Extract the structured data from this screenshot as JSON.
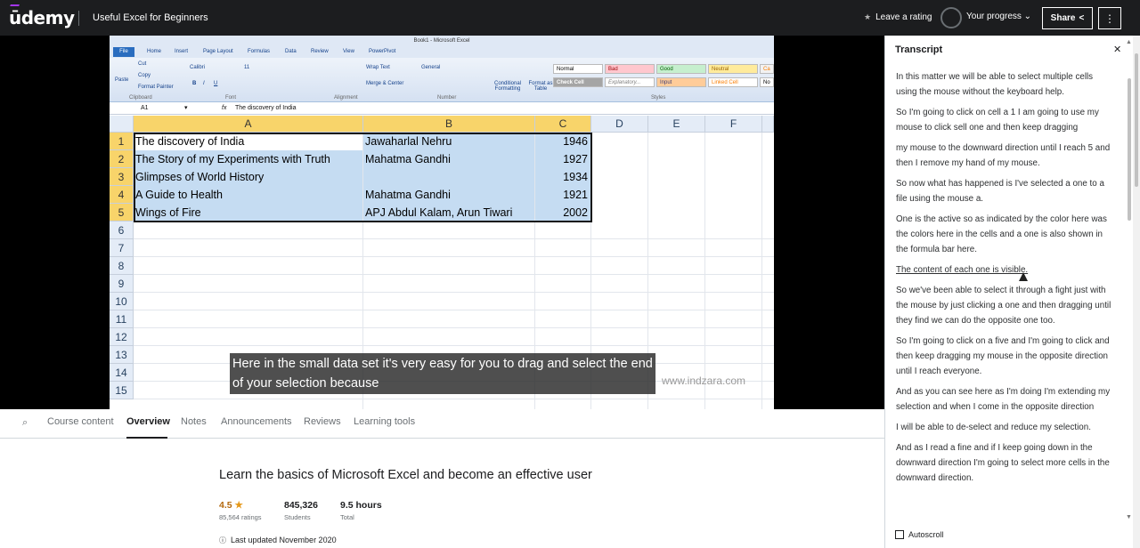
{
  "topbar": {
    "logo": "ūdemy",
    "course_title": "Useful Excel for Beginners",
    "leave_rating": "Leave a rating",
    "progress_label": "Your progress",
    "share_label": "Share",
    "more_icon": "kebab-icon"
  },
  "excel": {
    "window_title": "Book1 - Microsoft Excel",
    "file_tab": "File",
    "ribbon_tabs": [
      "Home",
      "Insert",
      "Page Layout",
      "Formulas",
      "Data",
      "Review",
      "View",
      "PowerPivot"
    ],
    "clipboard": {
      "paste": "Paste",
      "cut": "Cut",
      "copy": "Copy",
      "format_painter": "Format Painter",
      "group": "Clipboard"
    },
    "font": {
      "name": "Calibri",
      "size": "11",
      "group": "Font"
    },
    "alignment": {
      "wrap": "Wrap Text",
      "merge": "Merge & Center",
      "group": "Alignment"
    },
    "number": {
      "format": "General",
      "group": "Number"
    },
    "styles": {
      "conditional": "Conditional Formatting",
      "format_table": "Format as Table",
      "group": "Styles",
      "cells": [
        "Normal",
        "Bad",
        "Good",
        "Neutral",
        "Ca",
        "Check Cell",
        "Explanatory...",
        "Input",
        "Linked Cell",
        "No"
      ]
    },
    "name_box": "A1",
    "fx": "fx",
    "formula": "The discovery of India",
    "columns": [
      "A",
      "B",
      "C",
      "D",
      "E",
      "F"
    ],
    "rows": [
      "1",
      "2",
      "3",
      "4",
      "5",
      "6",
      "7",
      "8",
      "9",
      "10",
      "11",
      "12",
      "13",
      "14",
      "15"
    ],
    "data": [
      {
        "a": "The discovery of India",
        "b": "Jawaharlal Nehru",
        "c": "1946"
      },
      {
        "a": "The Story of my Experiments with Truth",
        "b": "Mahatma Gandhi",
        "c": "1927"
      },
      {
        "a": "Glimpses of World History",
        "b": "",
        "c": "1934"
      },
      {
        "a": "A Guide to Health",
        "b": "Mahatma Gandhi",
        "c": "1921"
      },
      {
        "a": "Wings of Fire",
        "b": "APJ Abdul Kalam, Arun Tiwari",
        "c": "2002"
      }
    ]
  },
  "video": {
    "subtitle": "Here in the small data set it's very easy for you to drag and select the end of your selection because",
    "watermark": "www.indzara.com"
  },
  "tabs": {
    "items": [
      "Course content",
      "Overview",
      "Notes",
      "Announcements",
      "Reviews",
      "Learning tools"
    ],
    "active": "Overview"
  },
  "overview": {
    "title": "Learn the basics of Microsoft Excel and become an effective user",
    "rating": "4.5",
    "ratings_count": "85,564 ratings",
    "students": "845,326",
    "students_label": "Students",
    "hours": "9.5 hours",
    "hours_label": "Total",
    "updated": "Last updated November 2020"
  },
  "transcript": {
    "title": "Transcript",
    "autoscroll": "Autoscroll",
    "lines": [
      "In this matter we will be able to select multiple cells using the mouse without the keyboard help.",
      "So I'm going to click on cell a 1 I am going to use my mouse to click sell one and then keep dragging",
      "my mouse to the downward direction until I reach 5 and then I remove my hand of my mouse.",
      "So now what has happened is I've selected a one to a file using the mouse a.",
      "One is the active so as indicated by the color here was the colors here in the cells and a one is also shown in the formula bar here.",
      "The content of each one is visible.",
      "So we've been able to select it through a fight just with the mouse by just clicking a one and then dragging until they find we can do the opposite one too.",
      "So I'm going to click on a five and I'm going to click and then keep dragging my mouse in the opposite direction until I reach everyone.",
      "And as you can see here as I'm doing I'm extending my selection and when I come in the opposite direction",
      "I will be able to de-select and reduce my selection.",
      "And as I read a fine and if I keep going down in the downward direction I'm going to select more cells in the downward direction."
    ],
    "active_index": 5
  }
}
